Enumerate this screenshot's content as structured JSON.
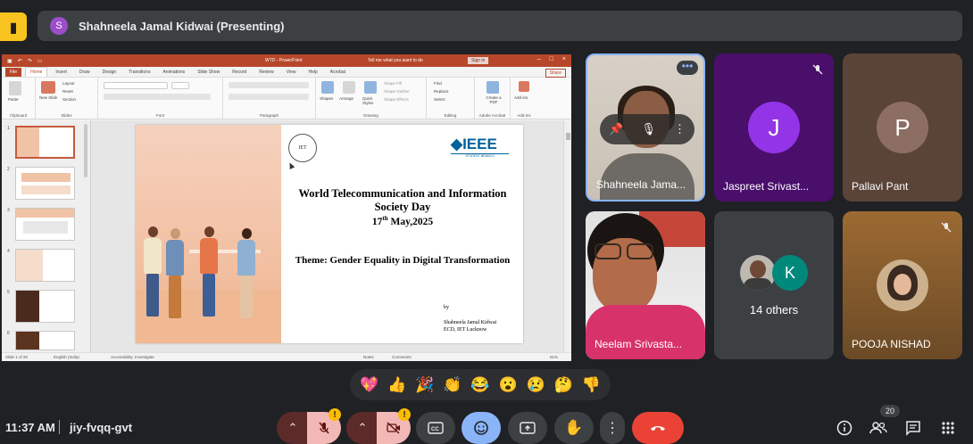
{
  "topbar": {
    "presenter_initial": "S",
    "presenter_label": "Shahneela Jamal Kidwai (Presenting)"
  },
  "ppt": {
    "doc_title": "WTD - PowerPoint",
    "tell_me": "Tell me what you want to do",
    "sign_in": "Sign in",
    "share": "Share",
    "tabs": [
      "File",
      "Home",
      "Insert",
      "Draw",
      "Design",
      "Transitions",
      "Animations",
      "Slide Show",
      "Record",
      "Review",
      "View",
      "Help",
      "Acrobat"
    ],
    "ribbon_groups": [
      "Clipboard",
      "Slides",
      "Font",
      "Paragraph",
      "Drawing",
      "Editing",
      "Adobe Acrobat",
      "Add-ins"
    ],
    "ribbon_labels": {
      "paste": "Paste",
      "new_slide": "New Slide",
      "layout": "Layout",
      "reset": "Reset",
      "section": "Section",
      "shapes": "Shapes",
      "arrange": "Arrange",
      "quick_styles": "Quick Styles",
      "shape_fill": "Shape Fill",
      "shape_outline": "Shape Outline",
      "shape_effects": "Shape Effects",
      "find": "Find",
      "replace": "Replace",
      "select": "Select",
      "create_pdf": "Create a PDF",
      "add_ins": "Add-ins"
    },
    "thumb_numbers": [
      "1",
      "2",
      "3",
      "4",
      "5",
      "6"
    ],
    "status": {
      "slide_of": "Slide 1 of 20",
      "language": "English (India)",
      "accessibility": "Accessibility: Investigate",
      "notes": "Notes",
      "comments": "Comments",
      "zoom": "61%"
    }
  },
  "slide": {
    "logo_left_text": "IET",
    "logo_right": "IEEE",
    "logo_right_sub": "STUDENT BRANCH",
    "heading_line1": "World Telecommunication and Information",
    "heading_line2": "Society Day",
    "date_main": "17",
    "date_sup": "th",
    "date_rest": " May,2025",
    "theme": "Theme: Gender Equality in Digital Transformation",
    "by": "by",
    "author_line1": "Shahneela Jamal Kidwai",
    "author_line2": "ECD, IET Lucknow"
  },
  "participants": [
    {
      "name": "Shahneela Jama...",
      "type": "video"
    },
    {
      "name": "Jaspreet Srivast...",
      "initial": "J",
      "avatar_color": "#9334e6",
      "muted": true
    },
    {
      "name": "Pallavi Pant",
      "initial": "P",
      "avatar_color": "#8d6e63"
    },
    {
      "name": "Neelam Srivasta...",
      "type": "video"
    },
    {
      "others_initial": "K",
      "others_label": "14 others"
    },
    {
      "name": "POOJA NISHAD",
      "muted": true
    }
  ],
  "reactions": [
    "💖",
    "👍",
    "🎉",
    "👏",
    "😂",
    "😮",
    "😢",
    "🤔",
    "👎"
  ],
  "bottom": {
    "time": "11:37 AM",
    "meeting_code": "jiy-fvqq-gvt",
    "participant_count": "20",
    "warn_mark": "!"
  }
}
